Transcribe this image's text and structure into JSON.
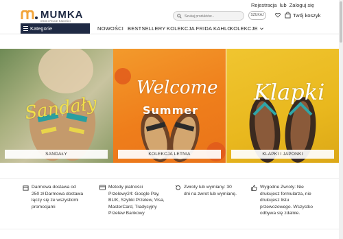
{
  "topbar": {
    "register": "Rejestracja",
    "or": "lub",
    "login": "Zaloguj się"
  },
  "brand": {
    "name": "MUMKA",
    "tagline": "KROKI PEŁNE RADOŚCI",
    "accent": "#f2a53b",
    "navy": "#1f2a44"
  },
  "search": {
    "placeholder": "Szukaj produktów...",
    "button": "SZUKAJ"
  },
  "header": {
    "cart_label": "Twój koszyk"
  },
  "nav": {
    "categories": "Kategorie",
    "items": [
      "NOWOŚCI",
      "BESTSELLERY",
      "KOLEKCJA FRIDA KAHLO",
      "KOLEKCJE"
    ]
  },
  "banners": [
    {
      "script": "Sandały",
      "label": "SANDAŁY"
    },
    {
      "script1": "Welcome",
      "script2": "Summer",
      "label": "KOLEKCJA LETNIA"
    },
    {
      "script": "Klapki",
      "label": "KLAPKI I JAPONKI"
    }
  ],
  "benefits": [
    {
      "icon": "box-icon",
      "lines": [
        "Darmowa dostawa od",
        "250 zł Darmowa dostawa",
        "łączy się ze wszystkimi",
        "promocjami"
      ]
    },
    {
      "icon": "card-icon",
      "lines": [
        "Metody płatności",
        "Przelewy24: Google Pay,",
        "BLIK, Szybki Przelew, Visa,",
        "MasterCard, Tradycyjny",
        "Przelew Bankowy"
      ]
    },
    {
      "icon": "return-icon",
      "lines": [
        "Zwroty lub wymiany: 30",
        "dni na zwrot lub wymianę."
      ]
    },
    {
      "icon": "thumb-up-icon",
      "lines": [
        "Wygodne Zwroty: Nie",
        "drukujesz formularza, nie",
        "drukujesz listu",
        "przewozowego. Wszystko",
        "odbywa się zdalnie."
      ]
    }
  ]
}
